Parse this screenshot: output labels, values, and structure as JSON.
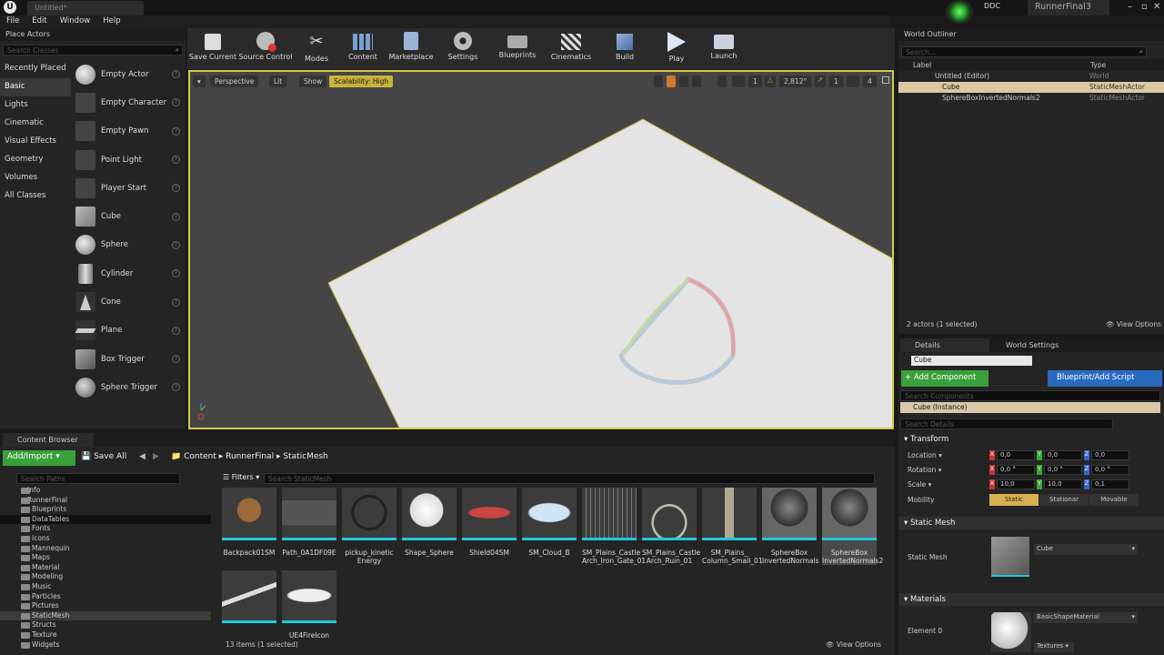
{
  "app": {
    "doc_tab": "Untitled*",
    "ddc": "DDC",
    "project": "RunnerFinal3",
    "menu": [
      "File",
      "Edit",
      "Window",
      "Help"
    ]
  },
  "place_actors": {
    "title": "Place Actors",
    "search_placeholder": "Search Classes",
    "categories": [
      "Recently Placed",
      "Basic",
      "Lights",
      "Cinematic",
      "Visual Effects",
      "Geometry",
      "Volumes",
      "All Classes"
    ],
    "items": [
      "Empty Actor",
      "Empty Character",
      "Empty Pawn",
      "Point Light",
      "Player Start",
      "Cube",
      "Sphere",
      "Cylinder",
      "Cone",
      "Plane",
      "Box Trigger",
      "Sphere Trigger"
    ]
  },
  "toolbar": {
    "buttons": [
      "Save Current",
      "Source Control",
      "Modes",
      "Content",
      "Marketplace",
      "Settings",
      "Blueprints",
      "Cinematics",
      "Build",
      "Play",
      "Launch"
    ]
  },
  "viewport": {
    "perspective": "Perspective",
    "lit": "Lit",
    "show": "Show",
    "scalability": "Scalability: High",
    "grid": "1",
    "rot": "2,812°",
    "scale": "1",
    "speed": "4"
  },
  "outliner": {
    "title": "World Outliner",
    "search_placeholder": "Search...",
    "col_label": "Label",
    "col_type": "Type",
    "rows": [
      {
        "label": "Untitled (Editor)",
        "type": "World"
      },
      {
        "label": "Cube",
        "type": "StaticMeshActor"
      },
      {
        "label": "SphereBoxInvertedNormals2",
        "type": "StaticMeshActor"
      }
    ],
    "count": "2 actors (1 selected)",
    "view_options": "View Options"
  },
  "details": {
    "tab_details": "Details",
    "tab_world": "World Settings",
    "name": "Cube",
    "add_component": "+ Add Component",
    "blueprint": "Blueprint/Add Script",
    "search_components": "Search Components",
    "instance": "Cube (Instance)",
    "search_details": "Search Details",
    "transform": "Transform",
    "location": "Location",
    "rotation": "Rotation",
    "scale": "Scale",
    "mobility": "Mobility",
    "loc": [
      "0,0",
      "0,0",
      "0,0"
    ],
    "rot": [
      "0,0 °",
      "0,0 °",
      "0,0 °"
    ],
    "scl": [
      "10,0",
      "10,0",
      "0,1"
    ],
    "mob": [
      "Static",
      "Stationar",
      "Movable"
    ],
    "static_mesh_section": "Static Mesh",
    "static_mesh_label": "Static Mesh",
    "static_mesh_value": "Cube",
    "materials": "Materials",
    "element0": "Element 0",
    "material_value": "BasicShapeMaterial",
    "textures": "Textures"
  },
  "content": {
    "title": "Content Browser",
    "add_import": "Add/Import",
    "save_all": "Save All",
    "path": [
      "Content",
      "RunnerFinal",
      "StaticMesh"
    ],
    "search_paths": "Search Paths",
    "filters": "Filters",
    "search_mesh": "Search StaticMesh",
    "folders": [
      "Info",
      "RunnerFinal",
      "Blueprints",
      "DataTables",
      "Fonts",
      "Icons",
      "Mannequin",
      "Maps",
      "Material",
      "Modeling",
      "Music",
      "Particles",
      "Pictures",
      "StaticMesh",
      "Structs",
      "Texture",
      "Widgets"
    ],
    "assets": [
      "Backpack01SM",
      "Path_0A1DF09E",
      "pickup_kinetic Energy",
      "Shape_Sphere",
      "Shield04SM",
      "SM_Cloud_B",
      "SM_Plains_Castle Arch_Iron_Gate_01",
      "SM_Plains_Castle Arch_Ruin_01",
      "SM_Plains_ Column_Small_01",
      "SphereBox InvertedNormals",
      "SphereBox InvertedNormals2",
      "",
      "UE4FireIcon"
    ],
    "count": "13 items (1 selected)",
    "view_options": "View Options"
  }
}
